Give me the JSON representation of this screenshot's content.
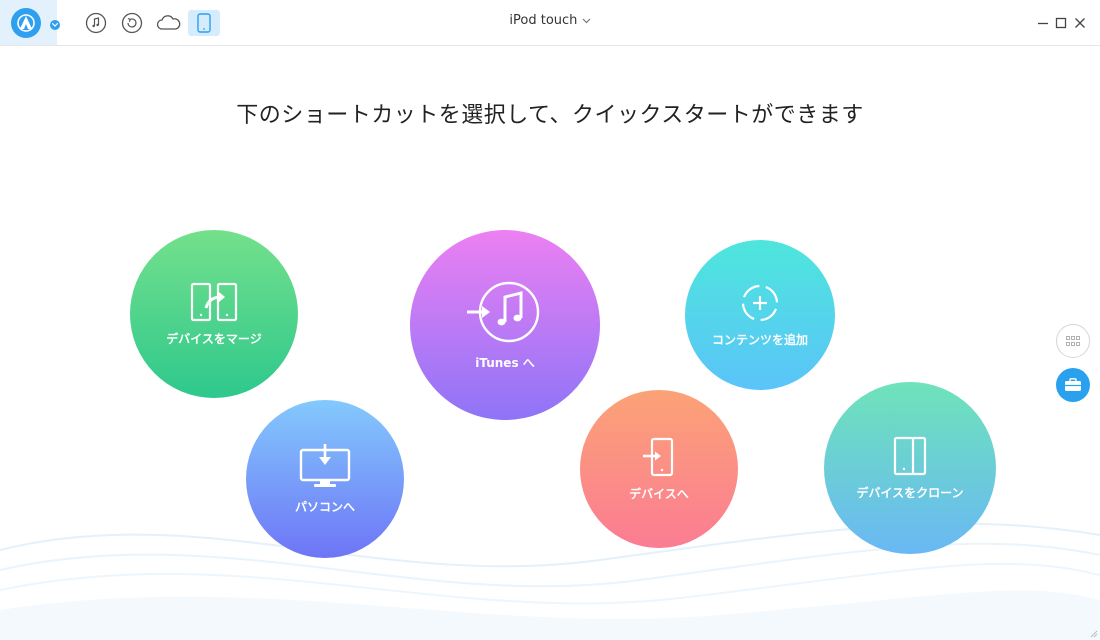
{
  "toolbar": {
    "logo_icon": "app-logo-icon",
    "buttons": [
      {
        "name": "music-icon"
      },
      {
        "name": "backup-icon"
      },
      {
        "name": "cloud-icon"
      },
      {
        "name": "device-icon",
        "active": true
      }
    ],
    "device_name": "iPod touch",
    "device_caret": "⌄"
  },
  "main": {
    "headline": "下のショートカットを選択して、クイックスタートができます",
    "shortcuts": [
      {
        "id": "merge",
        "label": "デバイスをマージ"
      },
      {
        "id": "pc",
        "label": "パソコンへ"
      },
      {
        "id": "itunes",
        "label": "iTunes へ"
      },
      {
        "id": "device",
        "label": "デバイスへ"
      },
      {
        "id": "content",
        "label": "コンテンツを追加"
      },
      {
        "id": "clone",
        "label": "デバイスをクローン"
      }
    ]
  },
  "side": {
    "grid_icon": "grid-view-icon",
    "toolbox_icon": "toolbox-icon"
  },
  "colors": {
    "accent": "#2f9ff0",
    "active_tab_bg": "#d4ecfb"
  }
}
